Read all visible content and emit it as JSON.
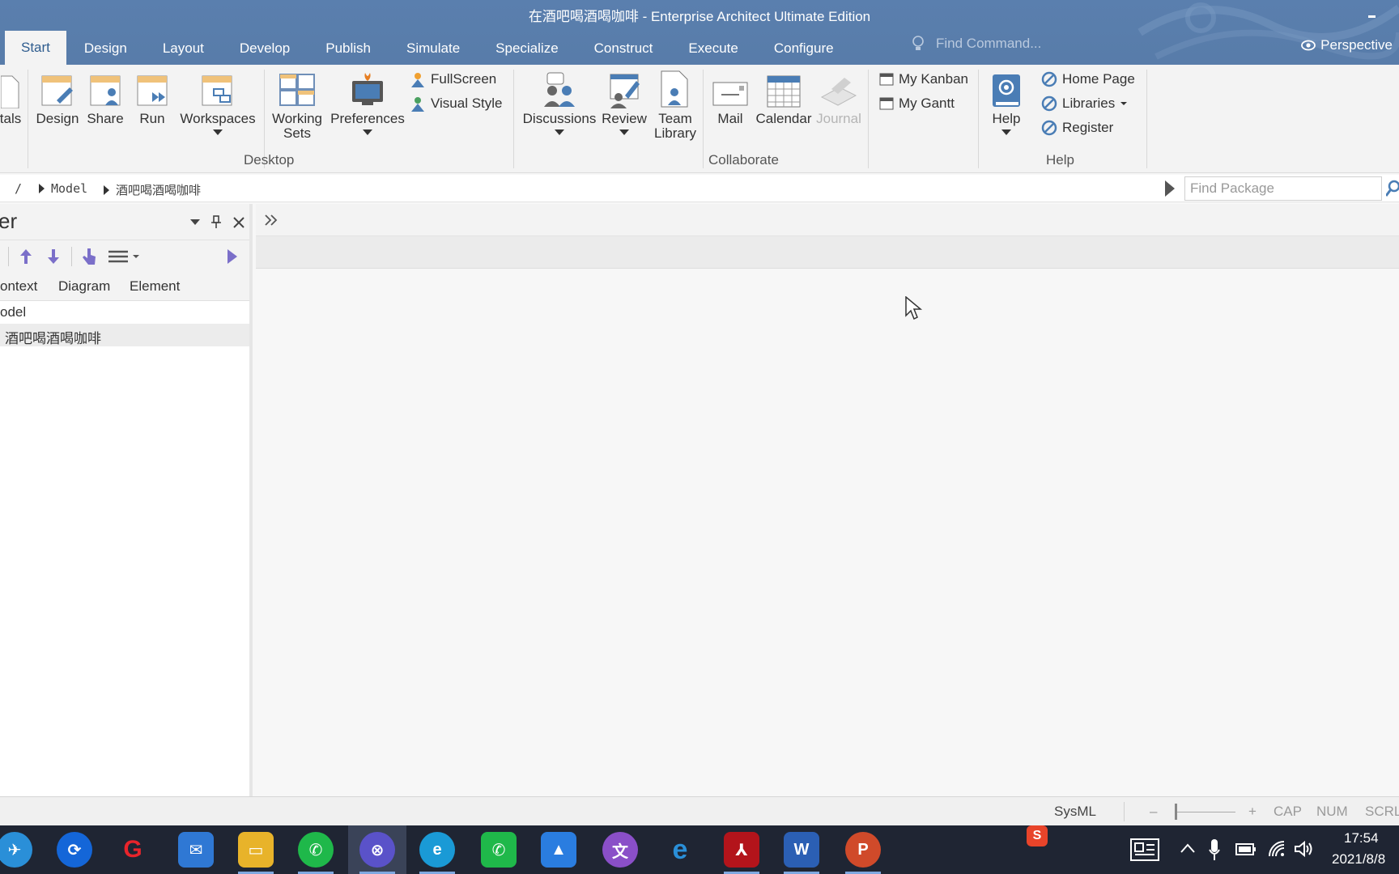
{
  "window": {
    "title": "在酒吧喝酒喝咖啡 - Enterprise Architect Ultimate Edition"
  },
  "tabs": [
    "Start",
    "Design",
    "Layout",
    "Develop",
    "Publish",
    "Simulate",
    "Specialize",
    "Construct",
    "Execute",
    "Configure"
  ],
  "find_command": {
    "placeholder": "Find Command..."
  },
  "perspective_label": "Perspective",
  "ribbon": {
    "partial_label": "tals",
    "desktop": {
      "label": "Desktop",
      "design": "Design",
      "share": "Share",
      "run": "Run",
      "workspaces": "Workspaces",
      "working_sets_1": "Working",
      "working_sets_2": "Sets",
      "preferences": "Preferences",
      "fullscreen": "FullScreen",
      "visual_style": "Visual Style"
    },
    "collaborate": {
      "label": "Collaborate",
      "discussions": "Discussions",
      "review": "Review",
      "team_library_1": "Team",
      "team_library_2": "Library",
      "mail": "Mail",
      "calendar": "Calendar",
      "journal": "Journal",
      "my_kanban": "My Kanban",
      "my_gantt": "My Gantt"
    },
    "help": {
      "label": "Help",
      "help": "Help",
      "home_page": "Home Page",
      "libraries": "Libraries",
      "register": "Register"
    }
  },
  "breadcrumb": {
    "root": "/",
    "model": "Model",
    "package": "酒吧喝酒喝咖啡"
  },
  "find_package": {
    "placeholder": "Find Package"
  },
  "browser": {
    "title": "er",
    "tabs": [
      "ontext",
      "Diagram",
      "Element"
    ],
    "tree": [
      {
        "label": "odel"
      },
      {
        "label": "酒吧喝酒喝咖啡"
      }
    ]
  },
  "status": {
    "mode": "SysML",
    "cap": "CAP",
    "num": "NUM",
    "scrl": "SCRL",
    "zoom_minus": "–",
    "zoom_plus": "+"
  },
  "taskbar": {
    "time": "17:54",
    "date": "2021/8/8"
  },
  "colors": {
    "accent": "#587ca9",
    "tab_active_text": "#2f5d8f",
    "icon_blue": "#4a7db5",
    "icon_purple": "#7b6fc9"
  }
}
